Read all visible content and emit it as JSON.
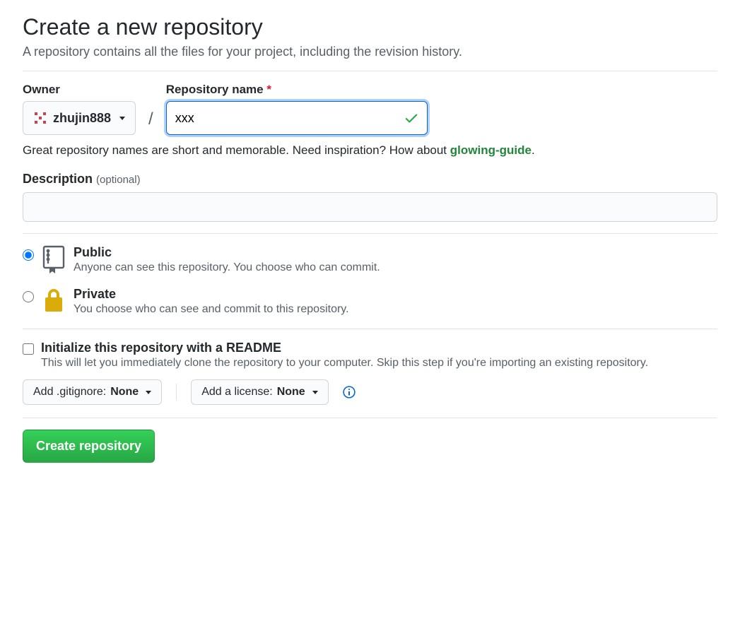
{
  "header": {
    "title": "Create a new repository",
    "subtitle": "A repository contains all the files for your project, including the revision history."
  },
  "owner": {
    "label": "Owner",
    "value": "zhujin888"
  },
  "repo_name": {
    "label": "Repository name",
    "required_mark": "*",
    "value": "xxx"
  },
  "hint": {
    "prefix": "Great repository names are short and memorable. Need inspiration? How about ",
    "suggestion": "glowing-guide",
    "suffix": "."
  },
  "description": {
    "label": "Description",
    "optional": "(optional)",
    "value": ""
  },
  "visibility": {
    "public": {
      "title": "Public",
      "desc": "Anyone can see this repository. You choose who can commit."
    },
    "private": {
      "title": "Private",
      "desc": "You choose who can see and commit to this repository."
    }
  },
  "init": {
    "title": "Initialize this repository with a README",
    "desc": "This will let you immediately clone the repository to your computer. Skip this step if you're importing an existing repository."
  },
  "gitignore": {
    "prefix": "Add .gitignore: ",
    "value": "None"
  },
  "license": {
    "prefix": "Add a license: ",
    "value": "None"
  },
  "submit": {
    "label": "Create repository"
  }
}
